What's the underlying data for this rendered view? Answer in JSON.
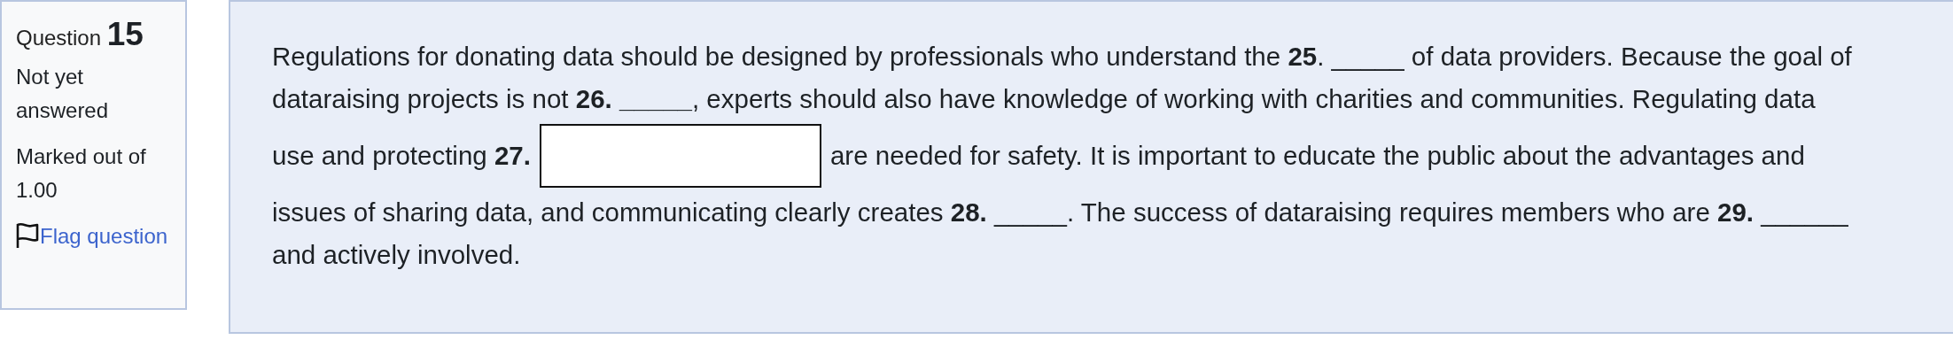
{
  "info": {
    "label": "Question",
    "number": "15",
    "state": "Not yet answered",
    "marks": "Marked out of 1.00",
    "flag": {
      "label": "Flag question",
      "flagged": false
    }
  },
  "question": {
    "lines": [
      {
        "kind": "text",
        "text": "Regulations for donating data should be designed by professionals who understand the **25**. _____ of data providers. Because the goal of"
      },
      {
        "kind": "text",
        "text": "dataraising projects is not **26. _____**, experts should also have knowledge of working with charities and communities. Regulating data"
      },
      {
        "kind": "field",
        "before": "use and protecting **27.**",
        "after": "are needed for safety. It is important to educate the public about the advantages and"
      },
      {
        "kind": "text",
        "text": "issues of sharing data, and communicating clearly creates **28.** _____. The success of dataraising requires members who are **29.** ______"
      },
      {
        "kind": "text",
        "text": "and actively involved."
      }
    ]
  }
}
